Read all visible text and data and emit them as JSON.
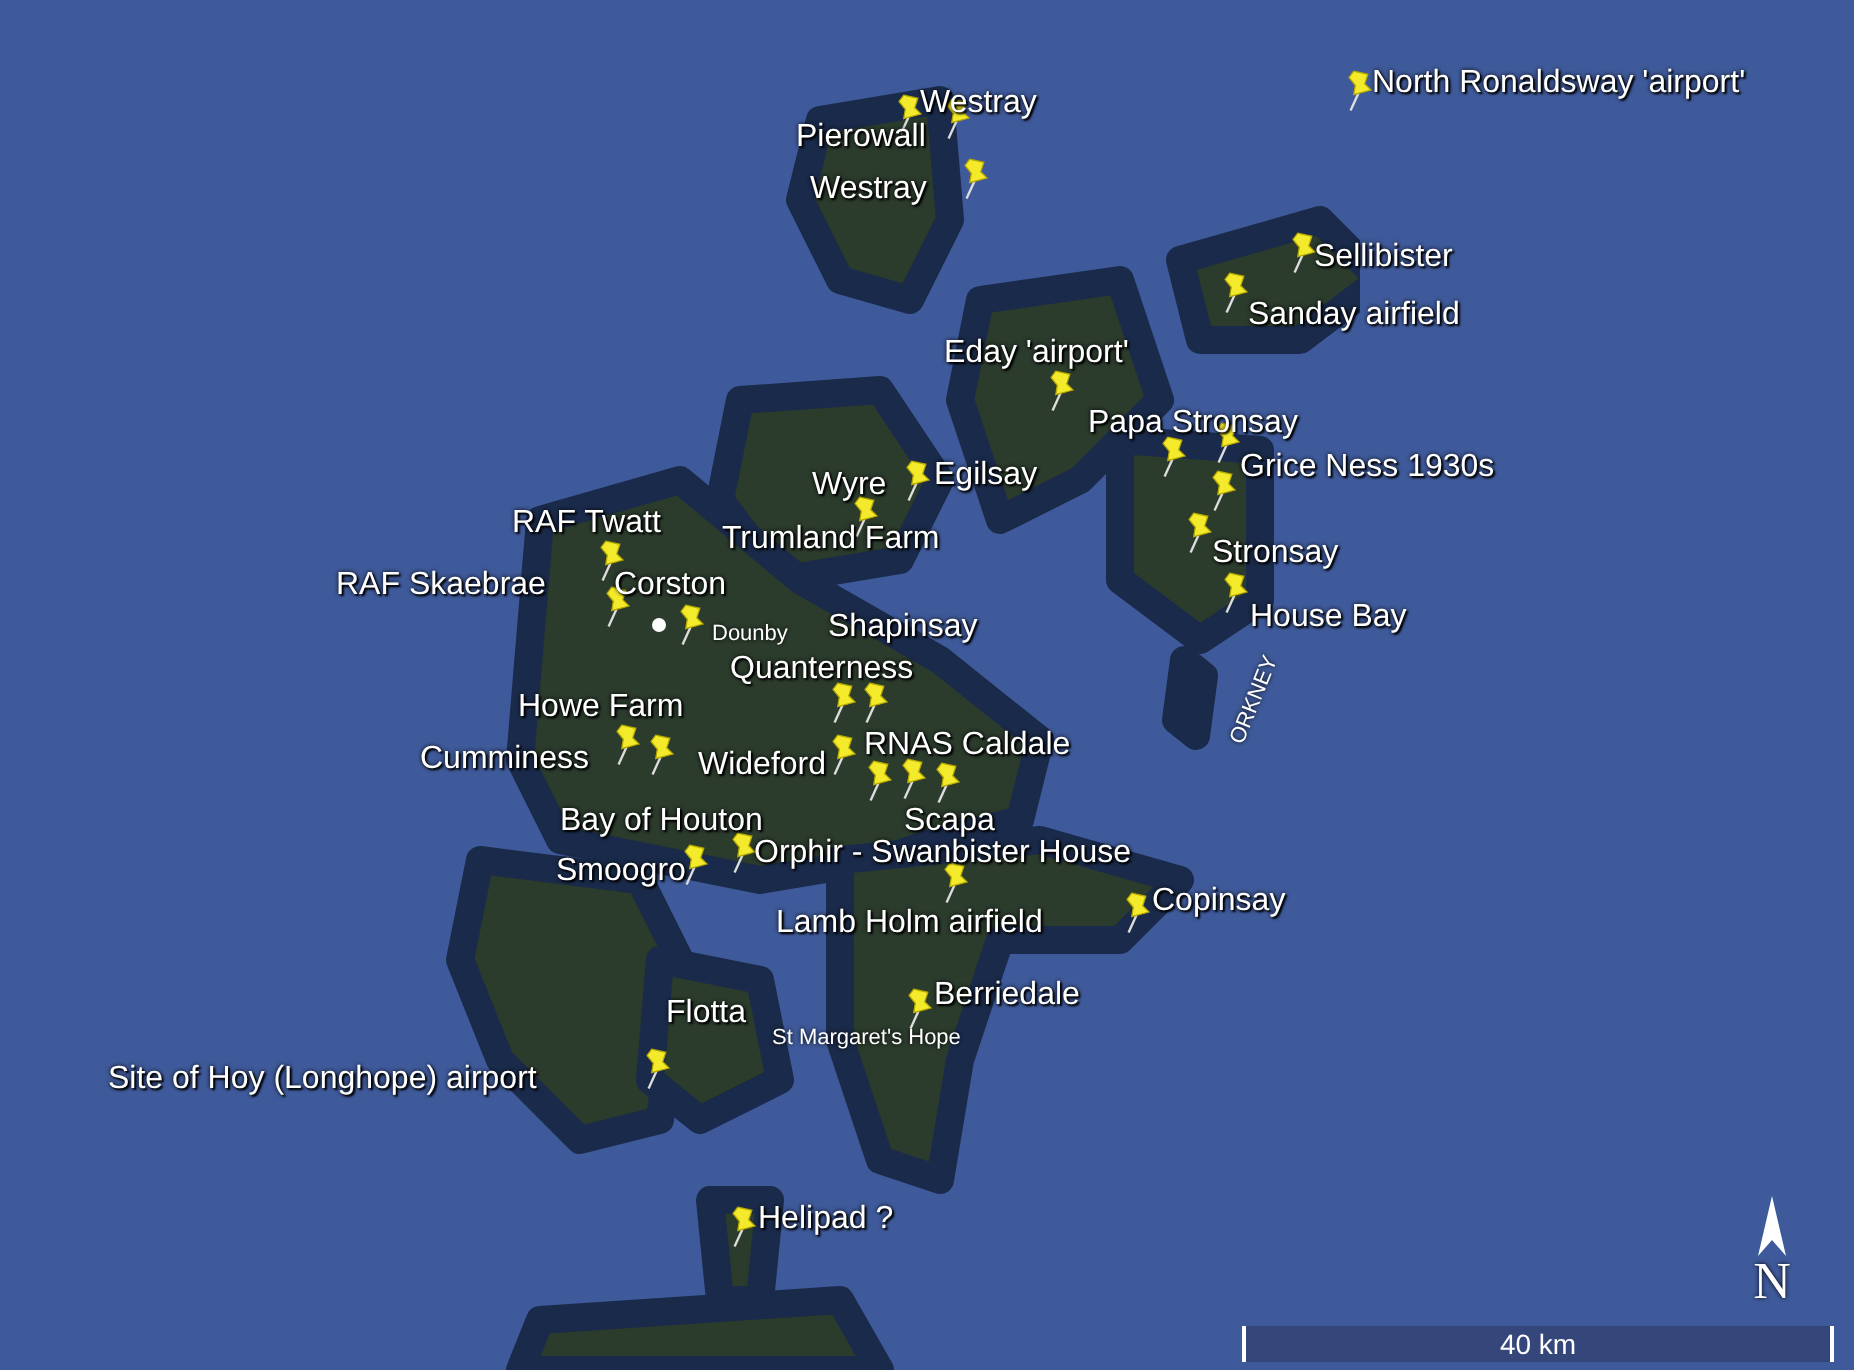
{
  "placemarks": [
    {
      "label": "Westray"
    },
    {
      "label": "Pierowall"
    },
    {
      "label": "Westray"
    },
    {
      "label": "North Ronaldsway 'airport'"
    },
    {
      "label": "Sellibister"
    },
    {
      "label": "Sanday airfield"
    },
    {
      "label": "Eday 'airport'"
    },
    {
      "label": "Papa Stronsay"
    },
    {
      "label": "Egilsay"
    },
    {
      "label": "Grice Ness 1930s"
    },
    {
      "label": "Wyre"
    },
    {
      "label": "Trumland Farm"
    },
    {
      "label": "RAF Twatt"
    },
    {
      "label": "Stronsay"
    },
    {
      "label": "RAF Skaebrae"
    },
    {
      "label": "Corston"
    },
    {
      "label": "House Bay"
    },
    {
      "label": "Shapinsay"
    },
    {
      "label": "Quanterness"
    },
    {
      "label": "Howe Farm"
    },
    {
      "label": "Cumminess"
    },
    {
      "label": "RNAS Caldale"
    },
    {
      "label": "Wideford"
    },
    {
      "label": "Scapa"
    },
    {
      "label": "Bay of Houton"
    },
    {
      "label": "Orphir - Swanbister House"
    },
    {
      "label": "Smoogro"
    },
    {
      "label": "Lamb Holm airfield"
    },
    {
      "label": "Copinsay"
    },
    {
      "label": "Berriedale"
    },
    {
      "label": "Flotta"
    },
    {
      "label": "Site of Hoy (Longhope) airport"
    },
    {
      "label": "Helipad ?"
    }
  ],
  "places": [
    {
      "name": "Dounby"
    },
    {
      "name": "St Margaret's Hope"
    }
  ],
  "region_label": "ORKNEY",
  "compass": "N",
  "scale_bar": "40 km"
}
